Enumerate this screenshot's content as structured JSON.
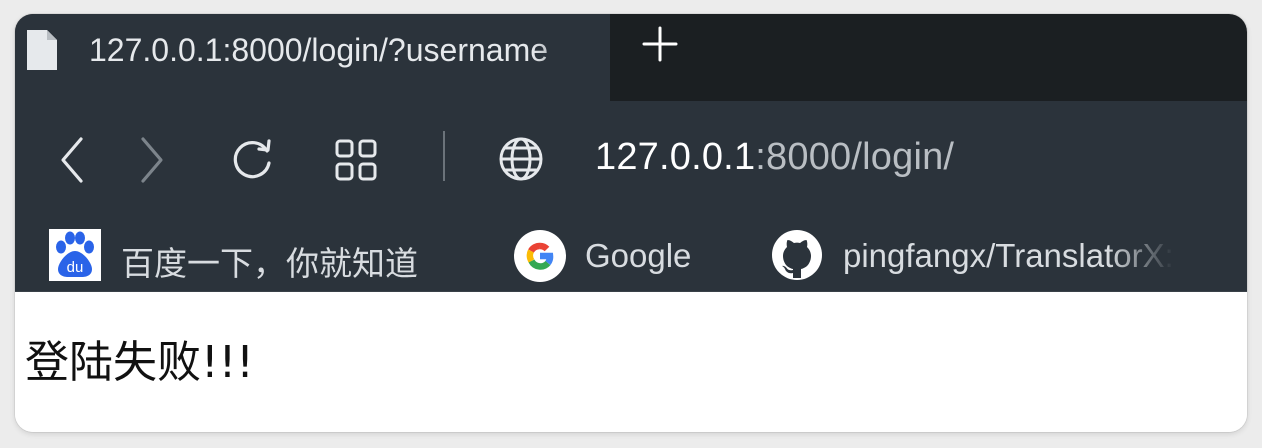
{
  "tab": {
    "title": "127.0.0.1:8000/login/?username",
    "icon": "document-icon"
  },
  "toolbar": {
    "url_host": "127.0.0.1",
    "url_rest": ":8000/login/",
    "icons": [
      "back-arrow-icon",
      "forward-arrow-icon",
      "reload-icon",
      "grid-icon",
      "globe-icon"
    ]
  },
  "bookmarks": [
    {
      "label": "百度一下，你就知道",
      "icon": "baidu-icon"
    },
    {
      "label": "Google",
      "icon": "google-icon"
    },
    {
      "label": "pingfangx/TranslatorX:",
      "icon": "github-icon"
    }
  ],
  "page": {
    "message": "登陆失败!!!"
  },
  "colors": {
    "chrome": "#2b333b",
    "tabbar": "#1b1f22",
    "url_host": "#ffffff",
    "url_path": "#b9bec3"
  }
}
